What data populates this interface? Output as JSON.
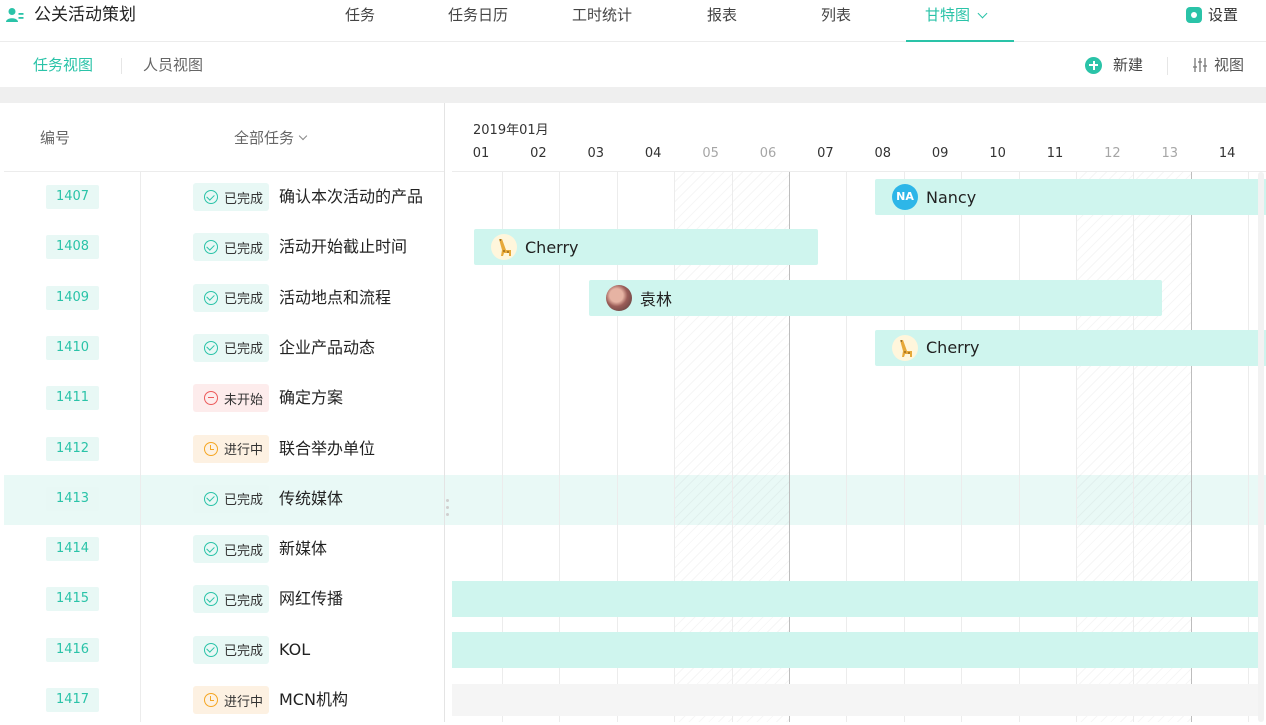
{
  "app": {
    "title": "公关活动策划",
    "icon": "team-icon"
  },
  "nav": {
    "items": [
      {
        "label": "任务"
      },
      {
        "label": "任务日历"
      },
      {
        "label": "工时统计"
      },
      {
        "label": "报表"
      },
      {
        "label": "列表"
      },
      {
        "label": "甘特图",
        "active": true
      }
    ],
    "settings_label": "设置"
  },
  "subnav": {
    "tabs": [
      {
        "label": "任务视图",
        "active": true
      },
      {
        "label": "人员视图"
      }
    ],
    "new_label": "新建",
    "view_label": "视图"
  },
  "table": {
    "col_number": "编号",
    "col_tasks": "全部任务"
  },
  "gantt": {
    "month_label": "2019年01月",
    "days": [
      "01",
      "02",
      "03",
      "04",
      "05",
      "06",
      "07",
      "08",
      "09",
      "10",
      "11",
      "12",
      "13",
      "14"
    ],
    "weekend_days": [
      "05",
      "06",
      "12",
      "13"
    ]
  },
  "rows": [
    {
      "id": "1407",
      "status": "已完成",
      "status_type": "done",
      "name": "确认本次活动的产品",
      "assignee": "Nancy",
      "avatar_text": "NA"
    },
    {
      "id": "1408",
      "status": "已完成",
      "status_type": "done",
      "name": "活动开始截止时间",
      "assignee": "Cherry"
    },
    {
      "id": "1409",
      "status": "已完成",
      "status_type": "done",
      "name": "活动地点和流程",
      "assignee": "袁林"
    },
    {
      "id": "1410",
      "status": "已完成",
      "status_type": "done",
      "name": "企业产品动态",
      "assignee": "Cherry"
    },
    {
      "id": "1411",
      "status": "未开始",
      "status_type": "notstart",
      "name": "确定方案"
    },
    {
      "id": "1412",
      "status": "进行中",
      "status_type": "progress",
      "name": "联合举办单位"
    },
    {
      "id": "1413",
      "status": "已完成",
      "status_type": "done",
      "name": "传统媒体"
    },
    {
      "id": "1414",
      "status": "已完成",
      "status_type": "done",
      "name": "新媒体"
    },
    {
      "id": "1415",
      "status": "已完成",
      "status_type": "done",
      "name": "网红传播"
    },
    {
      "id": "1416",
      "status": "已完成",
      "status_type": "done",
      "name": "KOL"
    },
    {
      "id": "1417",
      "status": "进行中",
      "status_type": "progress",
      "name": "MCN机构"
    }
  ],
  "colors": {
    "accent": "#2ac3a8",
    "bar": "#cff5ee",
    "done": "#2ac3a8",
    "notstart": "#ec5b5b",
    "progress": "#f5a623"
  }
}
